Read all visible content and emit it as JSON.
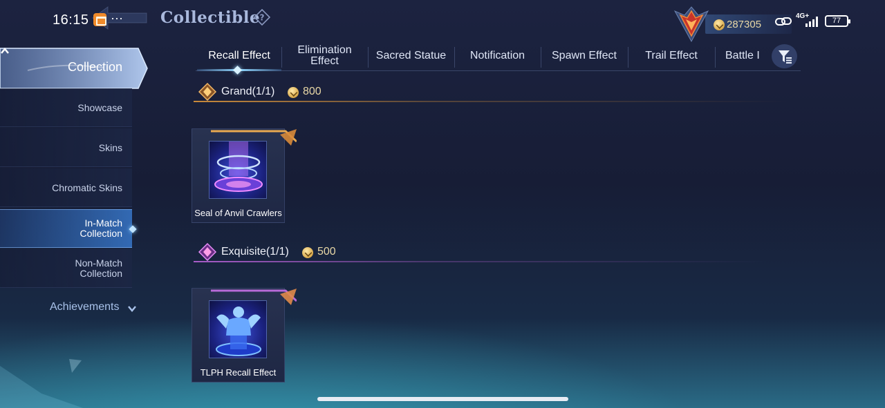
{
  "status_bar": {
    "time": "16:15",
    "more": "···",
    "network": "4G+",
    "battery": "77"
  },
  "header": {
    "title": "Collectible",
    "currency_value": "287305"
  },
  "sidebar": {
    "main": "Collection",
    "items": [
      {
        "label": "Showcase"
      },
      {
        "label": "Skins"
      },
      {
        "label": "Chromatic Skins"
      },
      {
        "label_line1": "In-Match",
        "label_line2": "Collection",
        "active": true
      },
      {
        "label_line1": "Non-Match",
        "label_line2": "Collection"
      }
    ],
    "achievements": "Achievements"
  },
  "tabs": [
    {
      "label": "Recall Effect",
      "active": true
    },
    {
      "label_line1": "Elimination",
      "label_line2": "Effect"
    },
    {
      "label": "Sacred Statue"
    },
    {
      "label": "Notification"
    },
    {
      "label": "Spawn Effect"
    },
    {
      "label": "Trail Effect"
    },
    {
      "label": "Battle I"
    }
  ],
  "sections": [
    {
      "label": "Grand(1/1)",
      "price": "800",
      "accent": "#c98a3a",
      "items": [
        {
          "name": "Seal of Anvil Crawlers",
          "icon": "anvil-seal-icon"
        }
      ]
    },
    {
      "label": "Exquisite(1/1)",
      "price": "500",
      "accent": "#a85cc8",
      "items": [
        {
          "name": "TLPH Recall Effect",
          "icon": "tlph-statue-icon"
        }
      ]
    }
  ],
  "colors": {
    "bg_top": "#1c2340",
    "bg_bottom": "#2a6b86",
    "grand_gold": "#c98a3a",
    "exquisite_purple": "#a85cc8",
    "active_blue": "#8fd6ff"
  }
}
